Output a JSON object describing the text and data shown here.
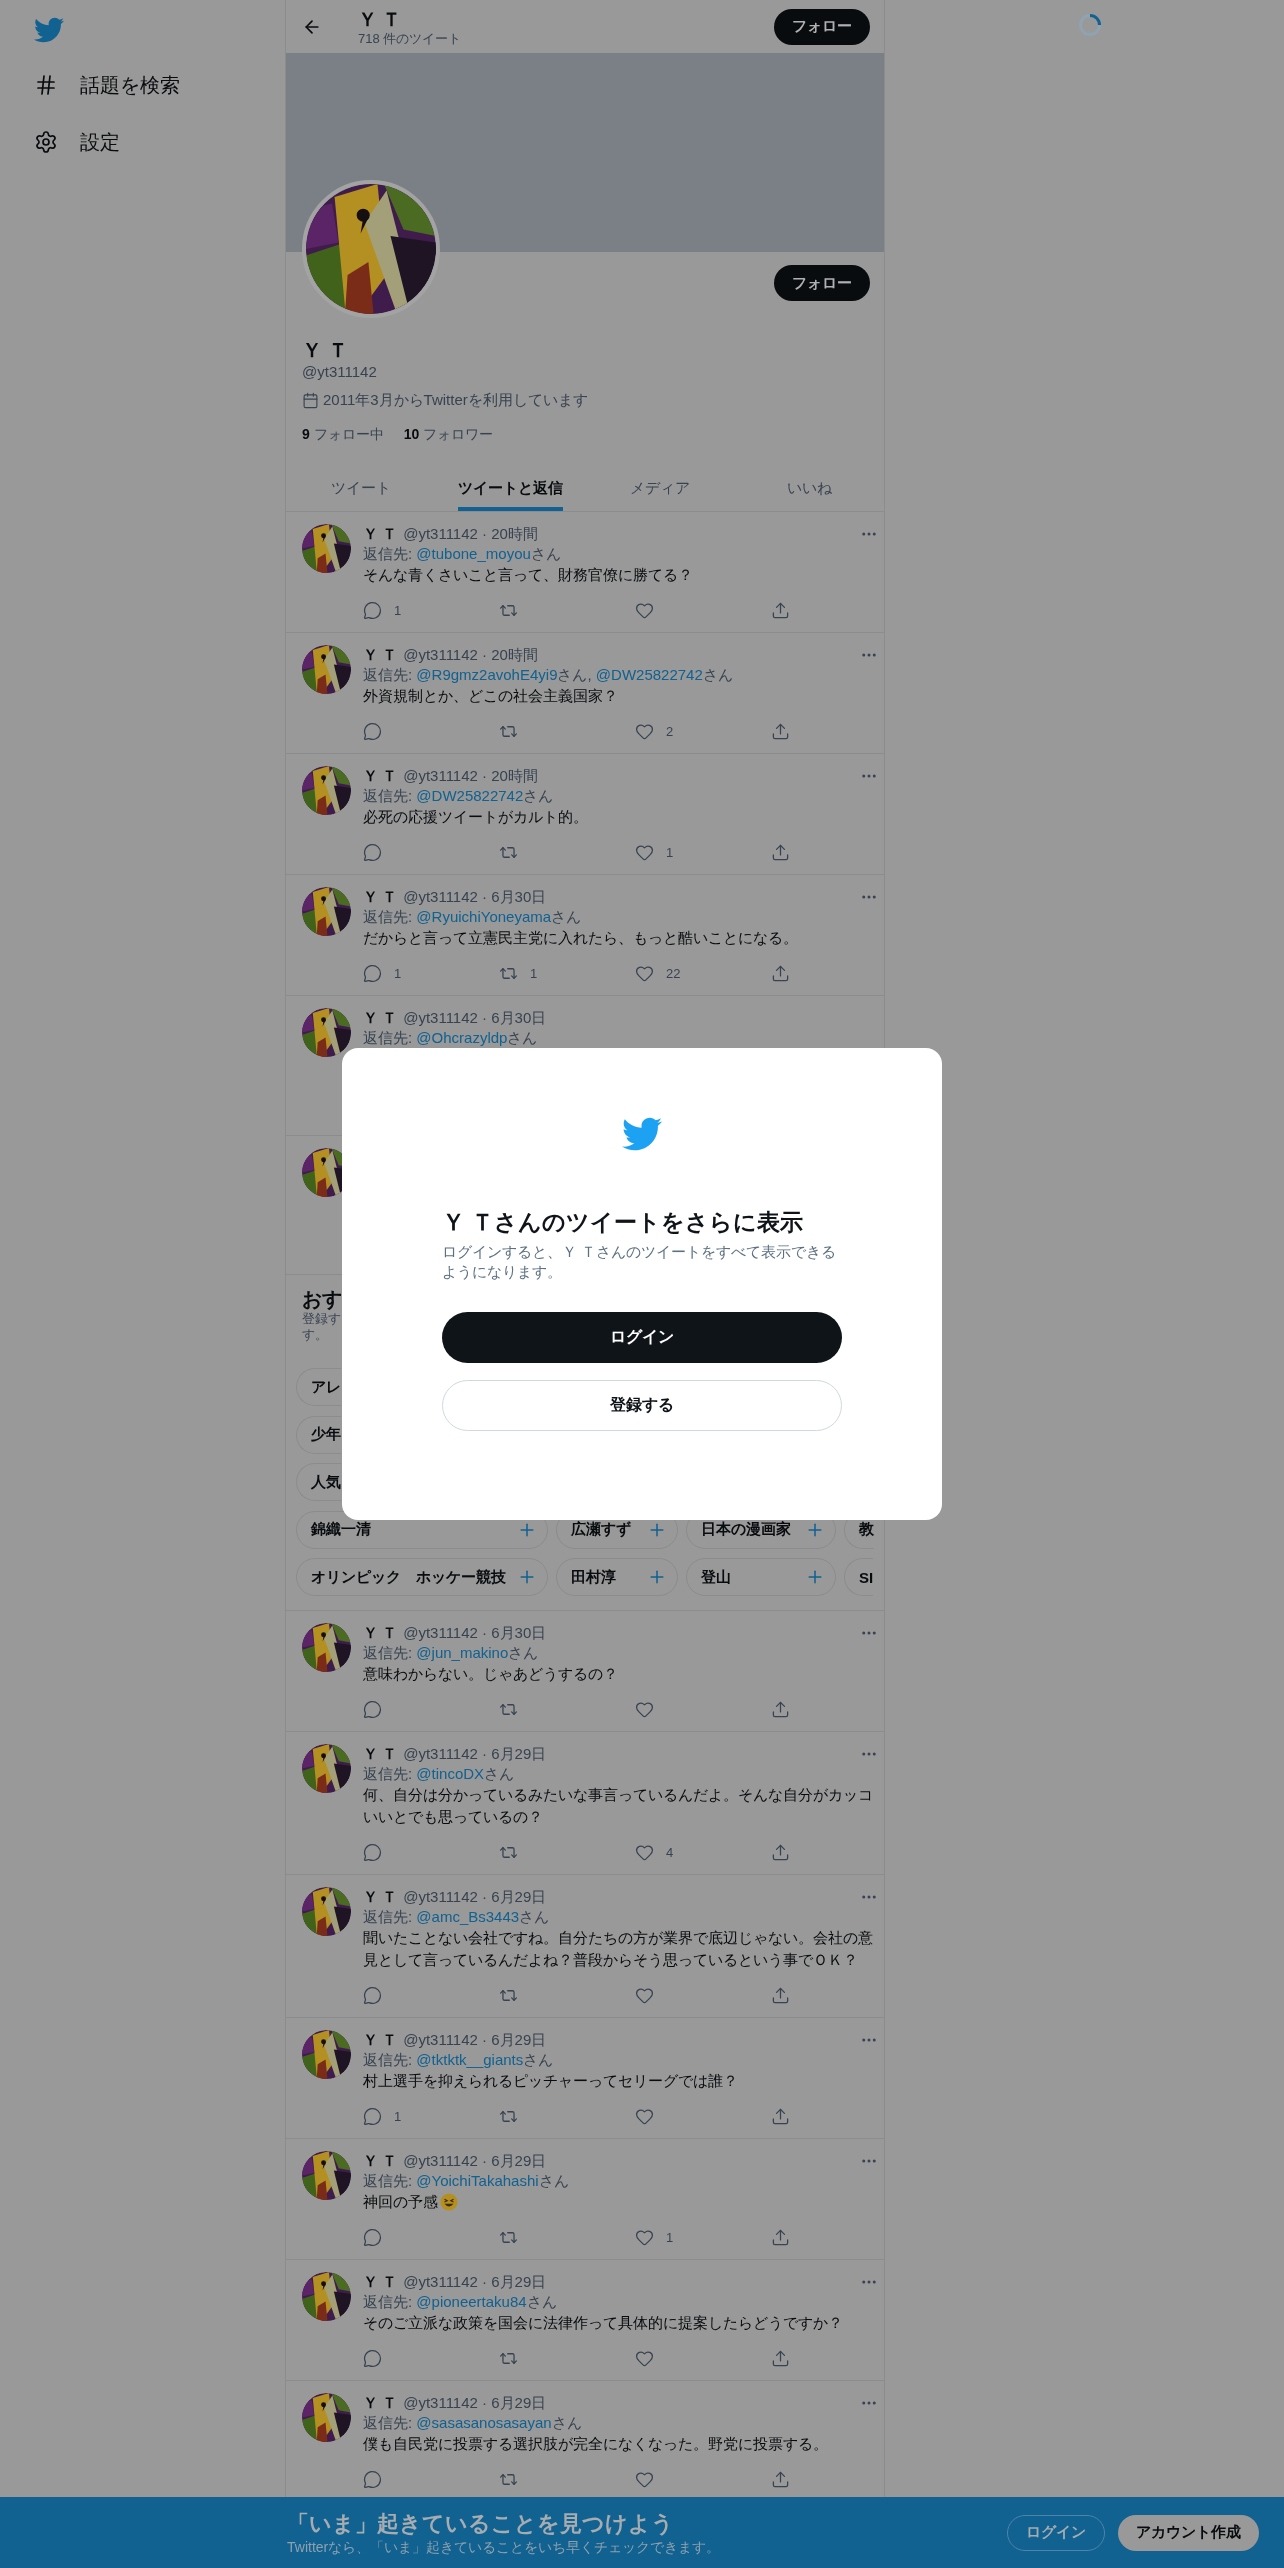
{
  "sidebar": {
    "items": [
      {
        "label": "話題を検索",
        "kind": "explore"
      },
      {
        "label": "設定",
        "kind": "settings"
      }
    ]
  },
  "header": {
    "title": "Ｙ Ｔ",
    "subtitle": "718 件のツイート",
    "button": "フォロー"
  },
  "profile": {
    "button": "フォロー",
    "name": "Ｙ Ｔ",
    "handle": "@yt311142",
    "joined": "2011年3月からTwitterを利用しています",
    "stats": [
      {
        "count": "9",
        "label": "フォロー中"
      },
      {
        "count": "10",
        "label": "フォロワー"
      }
    ]
  },
  "tabs": [
    {
      "label": "ツイート",
      "selected": false
    },
    {
      "label": "ツイートと返信",
      "selected": true
    },
    {
      "label": "メディア",
      "selected": false
    },
    {
      "label": "いいね",
      "selected": false
    }
  ],
  "tweets_before": [
    {
      "kind": "full",
      "name": "Ｙ Ｔ",
      "meta": "@yt311142 · 20時間",
      "reply_label": "返信先:",
      "mentions": [
        {
          "handle": "@tubone_moyou",
          "suffix": "さん"
        }
      ],
      "text": "そんな青くさいこと言って、財務官僚に勝てる？",
      "actions": [
        {
          "kind": "reply",
          "count": "1"
        },
        {
          "kind": "retweet"
        },
        {
          "kind": "like"
        },
        {
          "kind": "share"
        }
      ]
    },
    {
      "kind": "full",
      "name": "Ｙ Ｔ",
      "meta": "@yt311142 · 20時間",
      "reply_label": "返信先:",
      "mentions": [
        {
          "handle": "@R9gmz2avohE4yi9",
          "suffix": "さん,"
        },
        {
          "handle": "@DW25822742",
          "suffix": "さん"
        }
      ],
      "text": "外資規制とか、どこの社会主義国家？",
      "actions": [
        {
          "kind": "reply"
        },
        {
          "kind": "retweet"
        },
        {
          "kind": "like",
          "count": "2"
        },
        {
          "kind": "share"
        }
      ]
    },
    {
      "kind": "full",
      "name": "Ｙ Ｔ",
      "meta": "@yt311142 · 20時間",
      "reply_label": "返信先:",
      "mentions": [
        {
          "handle": "@DW25822742",
          "suffix": "さん"
        }
      ],
      "text": "必死の応援ツイートがカルト的。",
      "actions": [
        {
          "kind": "reply"
        },
        {
          "kind": "retweet"
        },
        {
          "kind": "like",
          "count": "1"
        },
        {
          "kind": "share"
        }
      ]
    },
    {
      "kind": "full",
      "name": "Ｙ Ｔ",
      "meta": "@yt311142 · 6月30日",
      "reply_label": "返信先:",
      "mentions": [
        {
          "handle": "@RyuichiYoneyama",
          "suffix": "さん"
        }
      ],
      "text": "だからと言って立憲民主党に入れたら、もっと酷いことになる。",
      "actions": [
        {
          "kind": "reply",
          "count": "1"
        },
        {
          "kind": "retweet",
          "count": "1"
        },
        {
          "kind": "like",
          "count": "22"
        },
        {
          "kind": "share"
        }
      ]
    },
    {
      "kind": "covered",
      "name": "Ｙ Ｔ",
      "meta": "@yt311142 · 6月30日",
      "reply_label": "返信先:",
      "mentions": [
        {
          "handle": "@Ohcrazyldp",
          "suffix": "さん"
        }
      ]
    },
    {
      "kind": "covered"
    }
  ],
  "recommend": {
    "title": "おす",
    "lines": [
      "登録す",
      "す。"
    ],
    "chips": [
      [
        {
          "label": "アレ",
          "kind": "cut"
        }
      ],
      [
        {
          "label": "少年",
          "kind": "cut"
        }
      ],
      [
        {
          "label": "人気",
          "kind": "cut"
        }
      ],
      [
        {
          "label": "錦織一清",
          "kind": "topic"
        },
        {
          "label": "広瀬すず",
          "kind": "topic"
        },
        {
          "label": "日本の漫画家",
          "kind": "topic"
        },
        {
          "label": "教",
          "kind": "cut"
        }
      ],
      [
        {
          "label": "オリンピック　ホッケー競技",
          "kind": "topic"
        },
        {
          "label": "田村淳",
          "kind": "topic"
        },
        {
          "label": "登山",
          "kind": "topic"
        },
        {
          "label": "SI",
          "kind": "cut"
        }
      ]
    ]
  },
  "tweets_after": [
    {
      "kind": "full",
      "name": "Ｙ Ｔ",
      "meta": "@yt311142 · 6月30日",
      "reply_label": "返信先:",
      "mentions": [
        {
          "handle": "@jun_makino",
          "suffix": "さん"
        }
      ],
      "text": "意味わからない。じゃあどうするの？",
      "actions": [
        {
          "kind": "reply"
        },
        {
          "kind": "retweet"
        },
        {
          "kind": "like"
        },
        {
          "kind": "share"
        }
      ]
    },
    {
      "kind": "full",
      "name": "Ｙ Ｔ",
      "meta": "@yt311142 · 6月29日",
      "reply_label": "返信先:",
      "mentions": [
        {
          "handle": "@tincoDX",
          "suffix": "さん"
        }
      ],
      "text": "何、自分は分かっているみたいな事言っているんだよ。そんな自分がカッコいいとでも思っているの？",
      "actions": [
        {
          "kind": "reply"
        },
        {
          "kind": "retweet"
        },
        {
          "kind": "like",
          "count": "4"
        },
        {
          "kind": "share"
        }
      ]
    },
    {
      "kind": "full",
      "name": "Ｙ Ｔ",
      "meta": "@yt311142 · 6月29日",
      "reply_label": "返信先:",
      "mentions": [
        {
          "handle": "@amc_Bs3443",
          "suffix": "さん"
        }
      ],
      "text": "聞いたことない会社ですね。自分たちの方が業界で底辺じゃない。会社の意見として言っているんだよね？普段からそう思っているという事でＯＫ？",
      "actions": [
        {
          "kind": "reply"
        },
        {
          "kind": "retweet"
        },
        {
          "kind": "like"
        },
        {
          "kind": "share"
        }
      ]
    },
    {
      "kind": "full",
      "name": "Ｙ Ｔ",
      "meta": "@yt311142 · 6月29日",
      "reply_label": "返信先:",
      "mentions": [
        {
          "handle": "@tktktk__giants",
          "suffix": "さん"
        }
      ],
      "text": "村上選手を抑えられるピッチャーってセリーグでは誰？",
      "actions": [
        {
          "kind": "reply",
          "count": "1"
        },
        {
          "kind": "retweet"
        },
        {
          "kind": "like"
        },
        {
          "kind": "share"
        }
      ]
    },
    {
      "kind": "full",
      "name": "Ｙ Ｔ",
      "meta": "@yt311142 · 6月29日",
      "reply_label": "返信先:",
      "mentions": [
        {
          "handle": "@YoichiTakahashi",
          "suffix": "さん"
        }
      ],
      "text": "神回の予感",
      "emoji": true,
      "actions": [
        {
          "kind": "reply"
        },
        {
          "kind": "retweet"
        },
        {
          "kind": "like",
          "count": "1"
        },
        {
          "kind": "share"
        }
      ]
    },
    {
      "kind": "full",
      "name": "Ｙ Ｔ",
      "meta": "@yt311142 · 6月29日",
      "reply_label": "返信先:",
      "mentions": [
        {
          "handle": "@pioneertaku84",
          "suffix": "さん"
        }
      ],
      "text": "そのご立派な政策を国会に法律作って具体的に提案したらどうですか？",
      "actions": [
        {
          "kind": "reply"
        },
        {
          "kind": "retweet"
        },
        {
          "kind": "like"
        },
        {
          "kind": "share"
        }
      ]
    },
    {
      "kind": "full",
      "name": "Ｙ Ｔ",
      "meta": "@yt311142 · 6月29日",
      "reply_label": "返信先:",
      "mentions": [
        {
          "handle": "@sasasanosasayan",
          "suffix": "さん"
        }
      ],
      "text": "僕も自民党に投票する選択肢が完全になくなった。野党に投票する。",
      "actions": [
        {
          "kind": "reply"
        },
        {
          "kind": "retweet"
        },
        {
          "kind": "like"
        },
        {
          "kind": "share"
        }
      ]
    }
  ],
  "dialog": {
    "title": "Ｙ Ｔさんのツイートをさらに表示",
    "text": "ログインすると、Ｙ Ｔさんのツイートをすべて表示できるようになります。",
    "login": "ログイン",
    "signup": "登録する"
  },
  "banner": {
    "title": "「いま」起きていることを見つけよう",
    "text": "Twitterなら、「いま」起きていることをいち早くチェックできます。",
    "login": "ログイン",
    "signup": "アカウント作成"
  }
}
